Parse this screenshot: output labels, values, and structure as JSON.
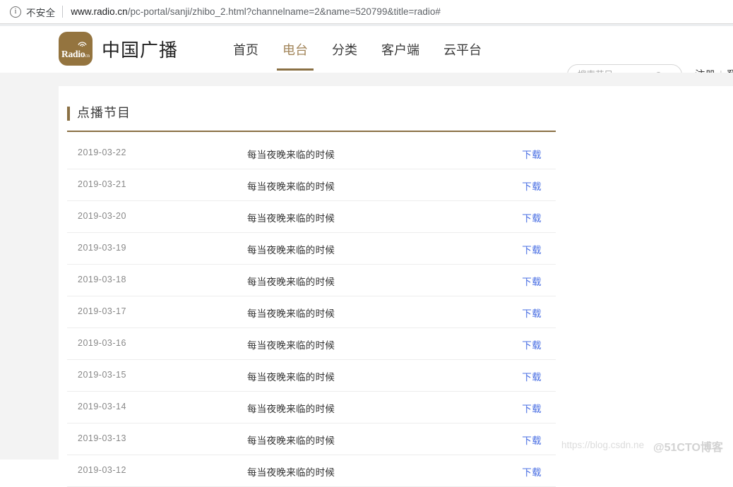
{
  "browser": {
    "security_label": "不安全",
    "security_icon": "info-circle-icon",
    "url_host": "www.radio.cn",
    "url_path": "/pc-portal/sanji/zhibo_2.html?channelname=2&name=520799&title=radio#"
  },
  "header": {
    "logo_word": "Radio",
    "logo_sub": "cn",
    "logo_color": "#94743f",
    "brand_name": "中国广播",
    "nav": [
      {
        "label": "首页",
        "active": false
      },
      {
        "label": "电台",
        "active": true
      },
      {
        "label": "分类",
        "active": false
      },
      {
        "label": "客户端",
        "active": false
      },
      {
        "label": "云平台",
        "active": false
      }
    ],
    "accent_color": "#8a7044",
    "active_nav_color": "#a2855a",
    "search": {
      "placeholder": "搜索节目",
      "value": "",
      "icon": "search-icon"
    },
    "account": {
      "register_label": "注册",
      "separator": "|",
      "login_label": "登"
    }
  },
  "main": {
    "section_title": "点播节目",
    "download_label": "下载",
    "link_color": "#4a6fe3",
    "rows": [
      {
        "date": "2019-03-22",
        "title": "每当夜晚来临的时候",
        "action": "下载"
      },
      {
        "date": "2019-03-21",
        "title": "每当夜晚来临的时候",
        "action": "下载"
      },
      {
        "date": "2019-03-20",
        "title": "每当夜晚来临的时候",
        "action": "下载"
      },
      {
        "date": "2019-03-19",
        "title": "每当夜晚来临的时候",
        "action": "下载"
      },
      {
        "date": "2019-03-18",
        "title": "每当夜晚来临的时候",
        "action": "下载"
      },
      {
        "date": "2019-03-17",
        "title": "每当夜晚来临的时候",
        "action": "下载"
      },
      {
        "date": "2019-03-16",
        "title": "每当夜晚来临的时候",
        "action": "下载"
      },
      {
        "date": "2019-03-15",
        "title": "每当夜晚来临的时候",
        "action": "下载"
      },
      {
        "date": "2019-03-14",
        "title": "每当夜晚来临的时候",
        "action": "下载"
      },
      {
        "date": "2019-03-13",
        "title": "每当夜晚来临的时候",
        "action": "下载"
      },
      {
        "date": "2019-03-12",
        "title": "每当夜晚来临的时候",
        "action": "下载"
      }
    ]
  },
  "watermarks": {
    "csdn": "https://blog.csdn.ne",
    "cto": "@51CTO博客"
  }
}
